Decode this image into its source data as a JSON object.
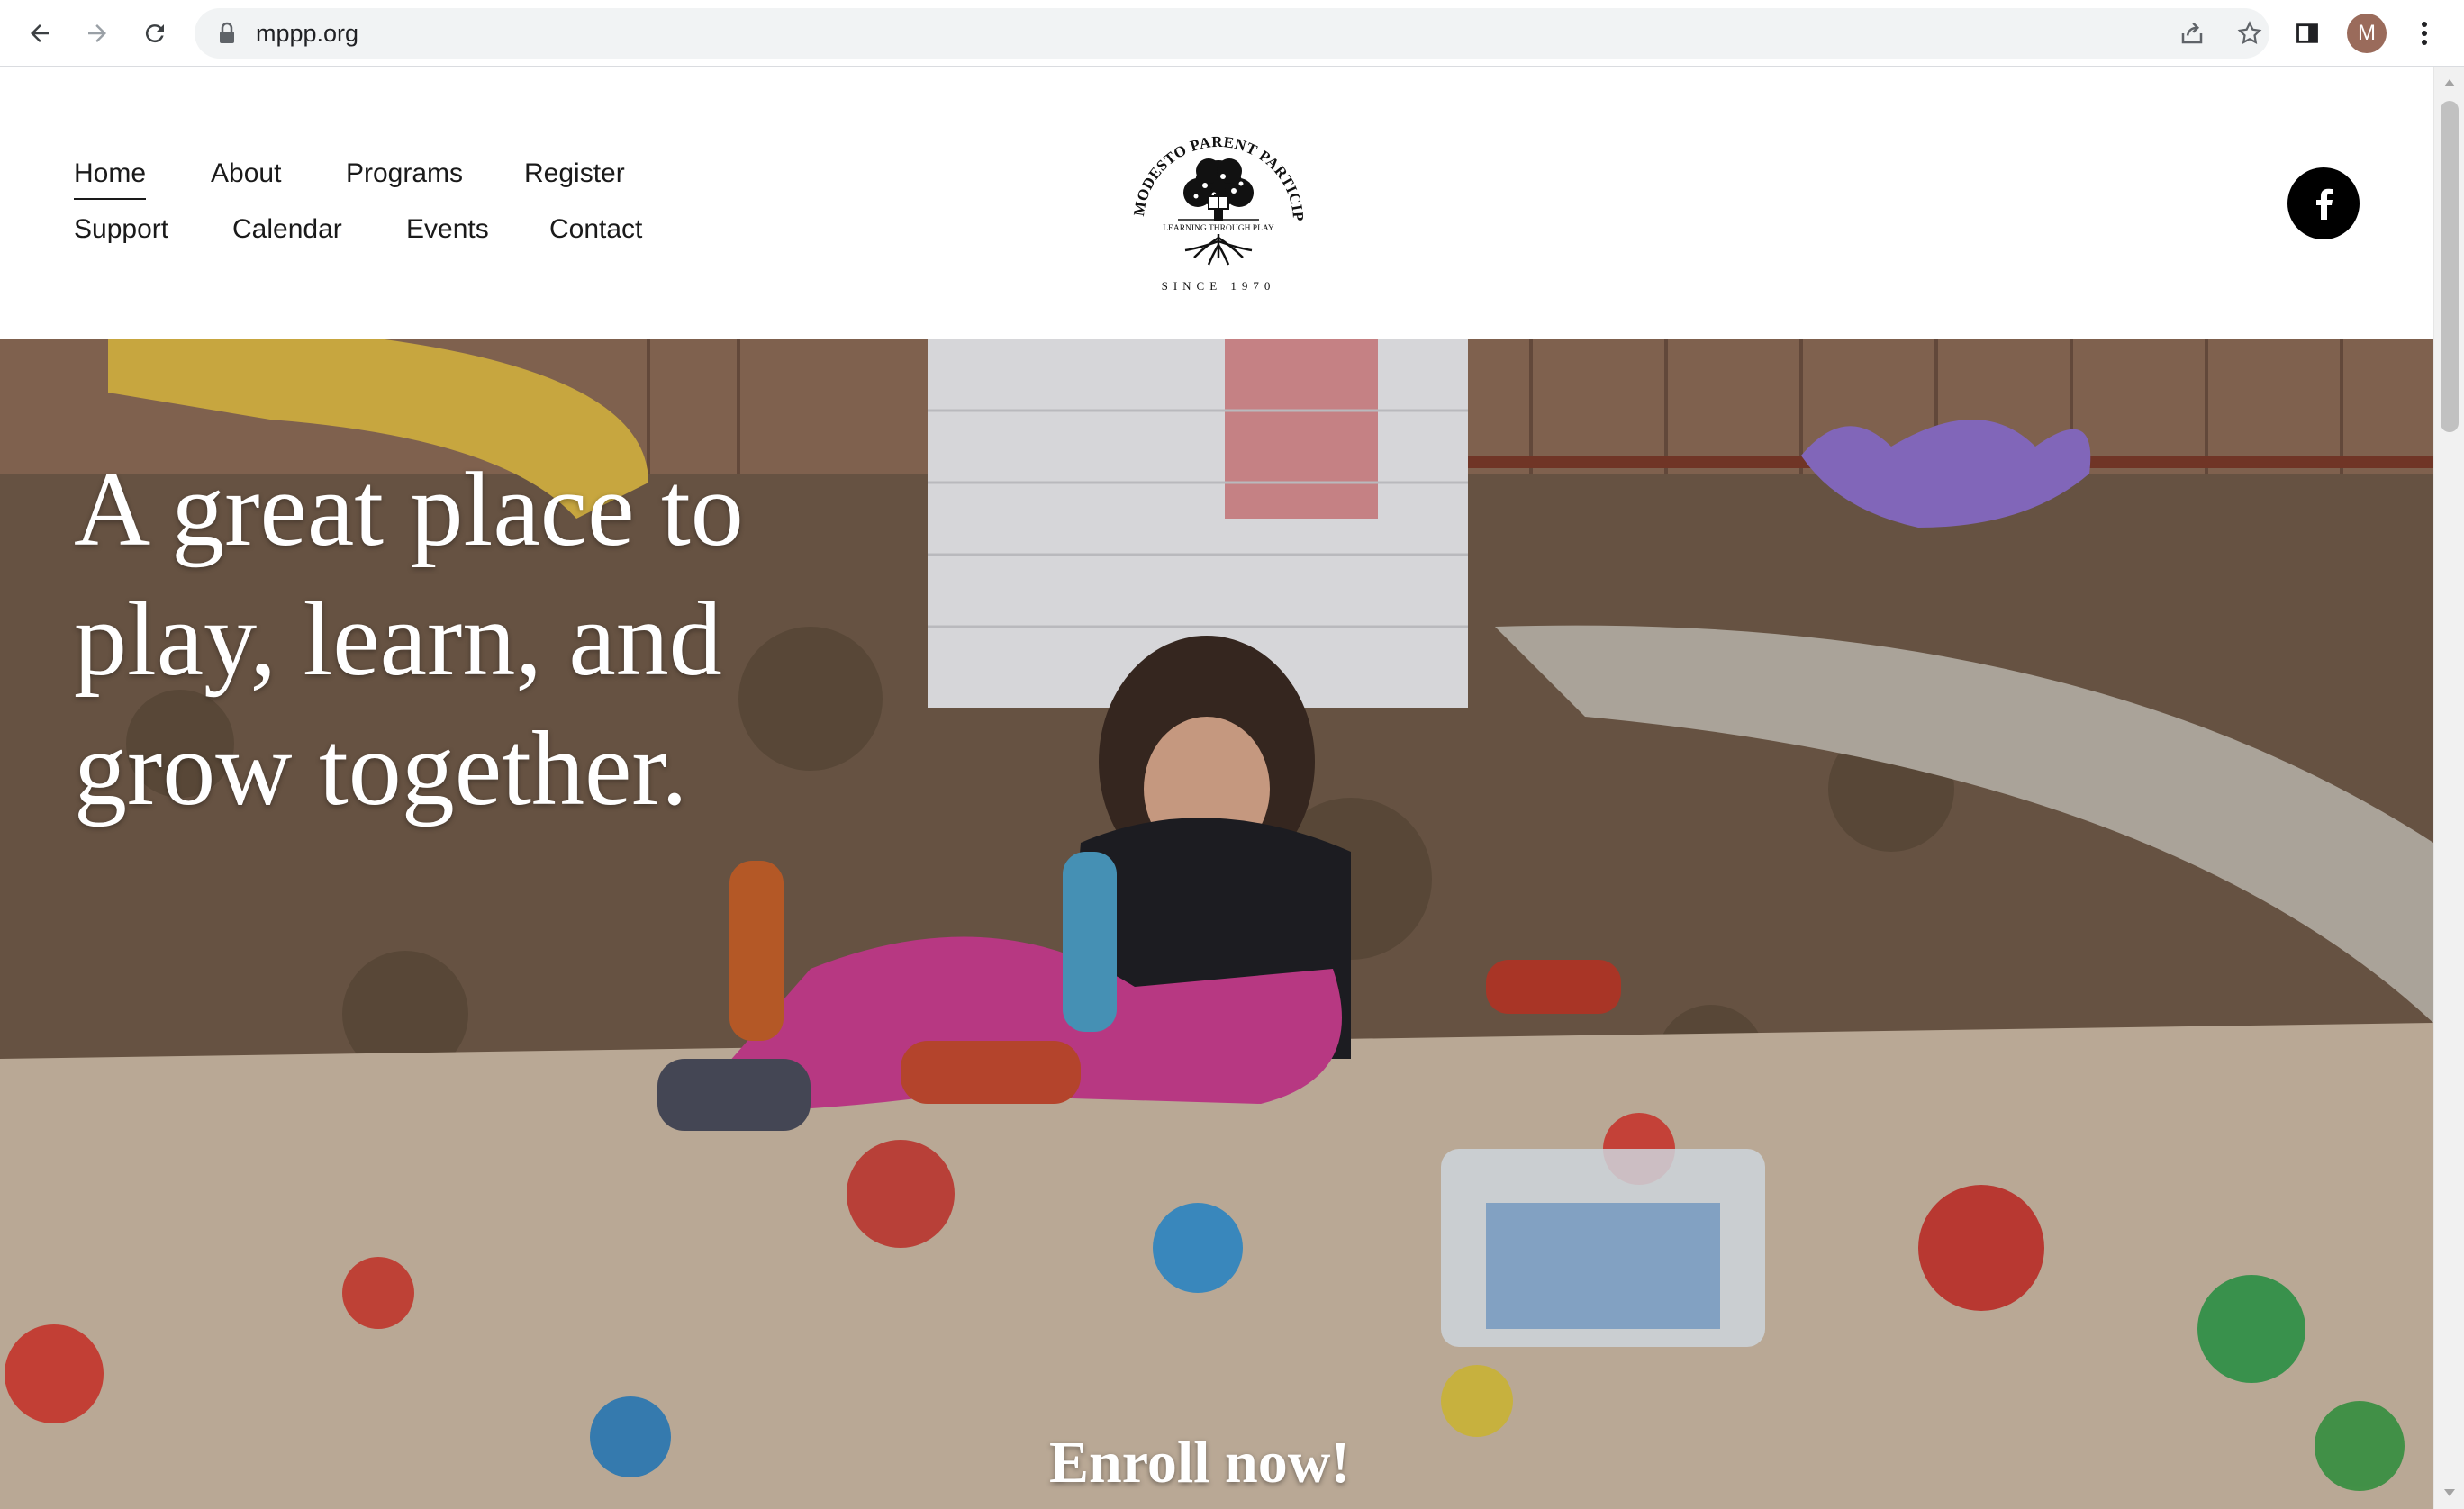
{
  "browser": {
    "url": "mppp.org",
    "profile_initial": "M",
    "icons": [
      "back-icon",
      "forward-icon",
      "reload-icon",
      "lock-icon",
      "share-icon",
      "star-icon",
      "side-panel-icon",
      "menu-icon"
    ]
  },
  "nav": {
    "items": [
      {
        "label": "Home",
        "active": true
      },
      {
        "label": "About"
      },
      {
        "label": "Programs"
      },
      {
        "label": "Register"
      },
      {
        "label": "Support"
      },
      {
        "label": "Calendar"
      },
      {
        "label": "Events"
      },
      {
        "label": "Contact"
      }
    ]
  },
  "logo": {
    "arc_text": "MODESTO PARENT PARTICIPATION PRE SCHOOL",
    "tagline": "LEARNING THROUGH PLAY",
    "since": "SINCE 1970"
  },
  "social": {
    "facebook_icon": "facebook-icon"
  },
  "hero": {
    "title_lines": [
      "A great place to",
      "play, learn, and",
      "grow together."
    ],
    "cta": "Enroll now!"
  },
  "colors": {
    "header_bg": "#ffffff",
    "text_dark": "#1a1a1a",
    "hero_text": "#ffffff",
    "facebook_bg": "#000000"
  }
}
